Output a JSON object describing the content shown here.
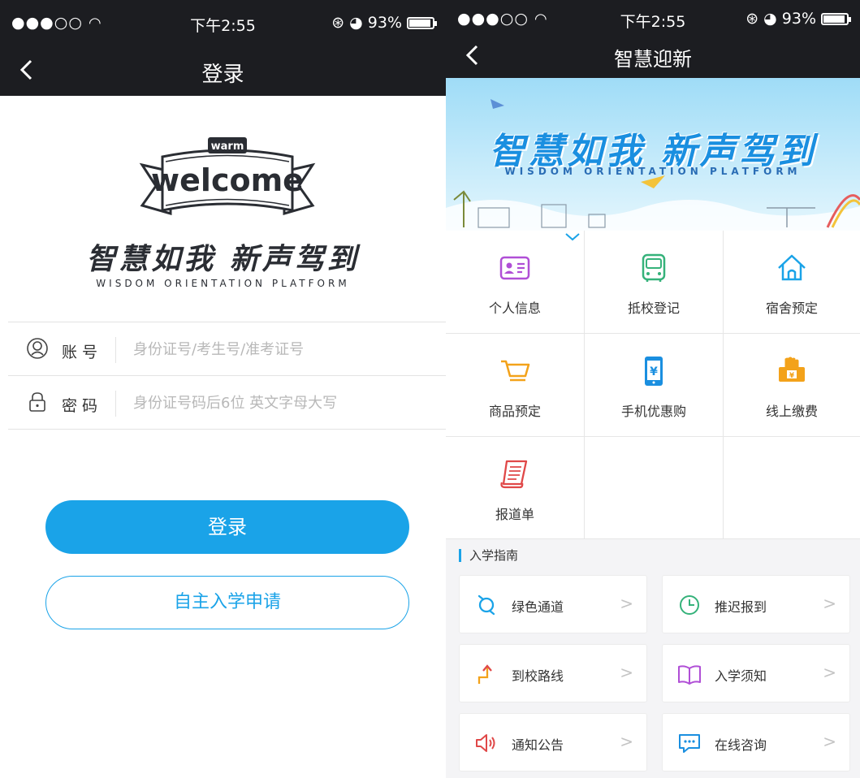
{
  "login": {
    "status": {
      "signal": "●●●○○",
      "time": "下午2:55",
      "battery": "93%",
      "battery_level": 0.93
    },
    "nav": {
      "title": "登录"
    },
    "logo": {
      "ribbon_small": "warm",
      "ribbon_text": "welcome",
      "slogan": "智慧如我 新声驾到",
      "slogan_en": "WISDOM ORIENTATION PLATFORM"
    },
    "form": {
      "account_label": "账号",
      "account_placeholder": "身份证号/考生号/准考证号",
      "password_label": "密码",
      "password_placeholder": "身份证号码后6位 英文字母大写"
    },
    "login_button": "登录",
    "apply_button": "自主入学申请"
  },
  "home": {
    "status": {
      "signal": "●●●○○",
      "time": "下午2:55",
      "battery": "93%",
      "battery_level": 0.93
    },
    "nav": {
      "title": "智慧迎新"
    },
    "banner": {
      "title": "智慧如我 新声驾到",
      "subtitle": "WISDOM ORIENTATION PLATFORM"
    },
    "grid": [
      {
        "label": "个人信息",
        "icon": "id-card-icon",
        "color": "#b04fd6"
      },
      {
        "label": "抵校登记",
        "icon": "bus-icon",
        "color": "#35b27a"
      },
      {
        "label": "宿舍预定",
        "icon": "house-icon",
        "color": "#1aa3e8"
      },
      {
        "label": "商品预定",
        "icon": "cart-icon",
        "color": "#f3a21a"
      },
      {
        "label": "手机优惠购",
        "icon": "phone-icon",
        "color": "#1a8fe0"
      },
      {
        "label": "线上缴费",
        "icon": "payment-icon",
        "color": "#f3a21a"
      },
      {
        "label": "报道单",
        "icon": "scroll-icon",
        "color": "#e04848"
      }
    ],
    "guide": {
      "title": "入学指南",
      "items": [
        {
          "label": "绿色通道",
          "icon": "green-channel-icon",
          "color": "#1aa3e8"
        },
        {
          "label": "推迟报到",
          "icon": "clock-icon",
          "color": "#35b27a"
        },
        {
          "label": "到校路线",
          "icon": "route-icon",
          "color": "#f3a21a"
        },
        {
          "label": "入学须知",
          "icon": "book-icon",
          "color": "#b04fd6"
        },
        {
          "label": "通知公告",
          "icon": "speaker-icon",
          "color": "#e04848"
        },
        {
          "label": "在线咨询",
          "icon": "chat-icon",
          "color": "#1a8fe0"
        }
      ],
      "arrow": ">"
    }
  }
}
